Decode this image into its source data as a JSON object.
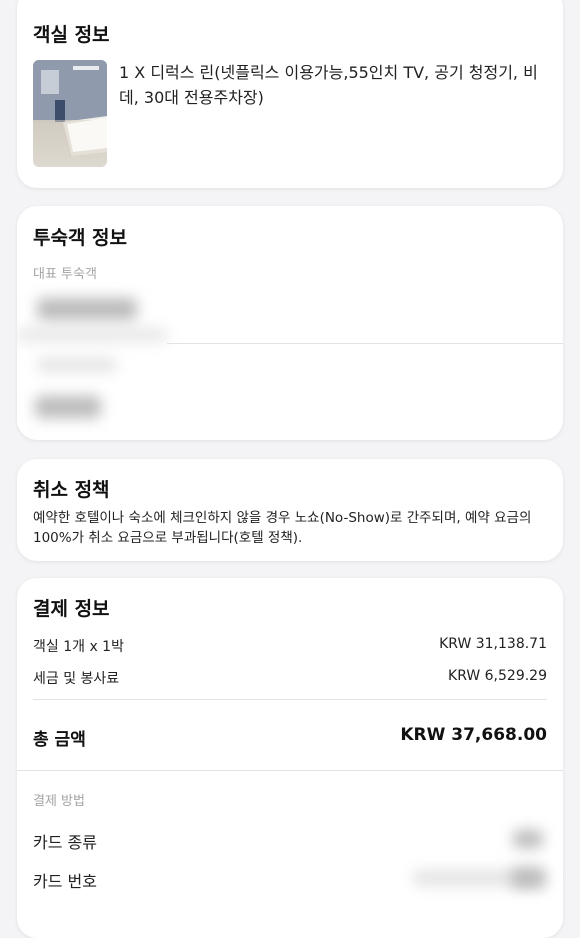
{
  "room_info": {
    "title": "객실 정보",
    "description": "1 X 디럭스 린(넷플릭스 이용가능,55인치 TV, 공기 청정기, 비데, 30대 전용주차장)"
  },
  "guest_info": {
    "title": "투숙객 정보",
    "lead_guest_label": "대표 투숙객"
  },
  "cancel_policy": {
    "title": "취소 정책",
    "text": "예약한 호텔이나 숙소에 체크인하지 않을 경우 노쇼(No-Show)로 간주되며, 예약 요금의 100%가 취소 요금으로 부과됩니다(호텔 정책)."
  },
  "payment_info": {
    "title": "결제 정보",
    "lines": [
      {
        "label": "객실 1개 x 1박",
        "value": "KRW 31,138.71"
      },
      {
        "label": "세금 및 봉사료",
        "value": "KRW 6,529.29"
      }
    ],
    "total_label": "총 금액",
    "total_value": "KRW 37,668.00",
    "method_section_label": "결제 방법",
    "card_type_label": "카드 종류",
    "card_number_label": "카드 번호"
  }
}
